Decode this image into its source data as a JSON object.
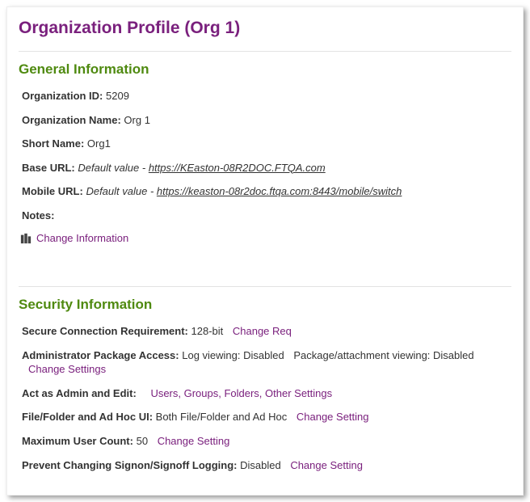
{
  "page": {
    "title": "Organization Profile (Org 1)"
  },
  "general": {
    "heading": "General Information",
    "rows": {
      "org_id": {
        "label": "Organization ID:",
        "value": "5209"
      },
      "org_name": {
        "label": "Organization Name:",
        "value": "Org 1"
      },
      "short_name": {
        "label": "Short Name:",
        "value": "Org1"
      },
      "base_url": {
        "label": "Base URL:",
        "prefix": "Default value - ",
        "url": "https://KEaston-08R2DOC.FTQA.com"
      },
      "mobile_url": {
        "label": "Mobile URL:",
        "prefix": "Default value - ",
        "url": "https://keaston-08r2doc.ftqa.com:8443/mobile/switch"
      },
      "notes": {
        "label": "Notes:"
      }
    },
    "change_link": "Change Information"
  },
  "security": {
    "heading": "Security Information",
    "secure_conn": {
      "label": "Secure Connection Requirement:",
      "value": "128-bit",
      "action": "Change Req"
    },
    "admin_pkg": {
      "label": "Administrator Package Access:",
      "segs": {
        "a": "Log viewing: Disabled",
        "b": "Package/attachment viewing: Disabled"
      },
      "action": "Change Settings"
    },
    "act_as_admin": {
      "label": "Act as Admin and Edit:",
      "action": "Users, Groups, Folders, Other Settings"
    },
    "ff_adhoc": {
      "label": "File/Folder and Ad Hoc UI:",
      "value": "Both File/Folder and Ad Hoc",
      "action": "Change Setting"
    },
    "max_user": {
      "label": "Maximum User Count:",
      "value": "50",
      "action": "Change Setting"
    },
    "prevent_log": {
      "label": "Prevent Changing Signon/Signoff Logging:",
      "value": "Disabled",
      "action": "Change Setting"
    }
  }
}
